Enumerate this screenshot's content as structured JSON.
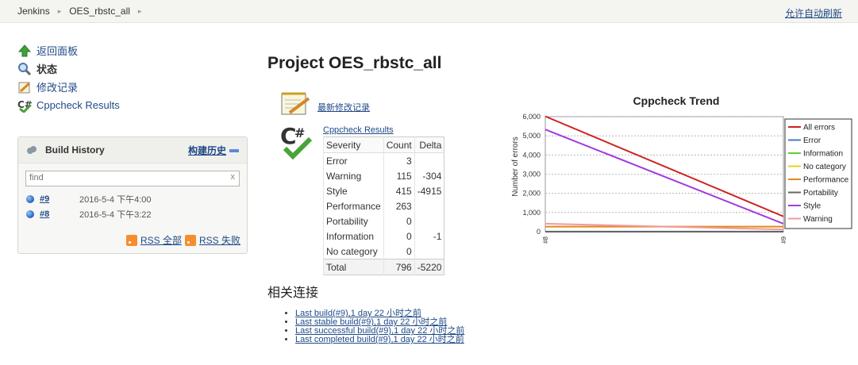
{
  "breadcrumb": {
    "items": [
      "Jenkins",
      "OES_rbstc_all"
    ],
    "sep": "▸"
  },
  "header": {
    "autorefresh": "允许自动刷新"
  },
  "sidebar": {
    "items": [
      {
        "label": "返回面板",
        "icon": "up-arrow-icon"
      },
      {
        "label": "状态",
        "icon": "search-icon"
      },
      {
        "label": "修改记录",
        "icon": "notepad-icon"
      },
      {
        "label": "Cppcheck Results",
        "icon": "cppcheck-icon"
      }
    ]
  },
  "build_history": {
    "title": "Build History",
    "trend_label": "构建历史",
    "search_placeholder": "find",
    "clear": "x",
    "builds": [
      {
        "id": "#9",
        "time": "2016-5-4 下午4:00"
      },
      {
        "id": "#8",
        "time": "2016-5-4 下午3:22"
      }
    ],
    "rss_all": "RSS 全部",
    "rss_failed": "RSS 失败"
  },
  "main": {
    "title": "Project OES_rbstc_all",
    "changes_link": "最新修改记录",
    "cppcheck_link": "Cppcheck Results",
    "table": {
      "headers": [
        "Severity",
        "Count",
        "Delta"
      ],
      "rows": [
        [
          "Error",
          "3",
          ""
        ],
        [
          "Warning",
          "115",
          "-304"
        ],
        [
          "Style",
          "415",
          "-4915"
        ],
        [
          "Performance",
          "263",
          ""
        ],
        [
          "Portability",
          "0",
          ""
        ],
        [
          "Information",
          "0",
          "-1"
        ],
        [
          "No category",
          "0",
          ""
        ]
      ],
      "total": [
        "Total",
        "796",
        "-5220"
      ]
    },
    "related_title": "相关连接",
    "related_links": [
      "Last build(#9),1 day 22 小时之前",
      "Last stable build(#9),1 day 22 小时之前",
      "Last successful build(#9),1 day 22 小时之前",
      "Last completed build(#9),1 day 22 小时之前"
    ]
  },
  "chart_data": {
    "type": "line",
    "title": "Cppcheck Trend",
    "ylabel": "Number of errors",
    "xlabel": "",
    "categories": [
      "#8",
      "#9"
    ],
    "ylim": [
      0,
      6000
    ],
    "yticks": [
      0,
      1000,
      2000,
      3000,
      4000,
      5000,
      6000
    ],
    "ytick_labels": [
      "0",
      "1,000",
      "2,000",
      "3,000",
      "4,000",
      "5,000",
      "6,000"
    ],
    "legend_position": "right",
    "grid": true,
    "series": [
      {
        "name": "All errors",
        "values": [
          6016,
          796
        ],
        "color": "#cc2222"
      },
      {
        "name": "Error",
        "values": [
          3,
          3
        ],
        "color": "#4477cc"
      },
      {
        "name": "Information",
        "values": [
          1,
          0
        ],
        "color": "#66cc33"
      },
      {
        "name": "No category",
        "values": [
          0,
          0
        ],
        "color": "#e6d21c"
      },
      {
        "name": "Performance",
        "values": [
          263,
          263
        ],
        "color": "#e08a1e"
      },
      {
        "name": "Portability",
        "values": [
          0,
          0
        ],
        "color": "#666666"
      },
      {
        "name": "Style",
        "values": [
          5330,
          415
        ],
        "color": "#a43ae0"
      },
      {
        "name": "Warning",
        "values": [
          419,
          115
        ],
        "color": "#f29a9a"
      }
    ]
  }
}
